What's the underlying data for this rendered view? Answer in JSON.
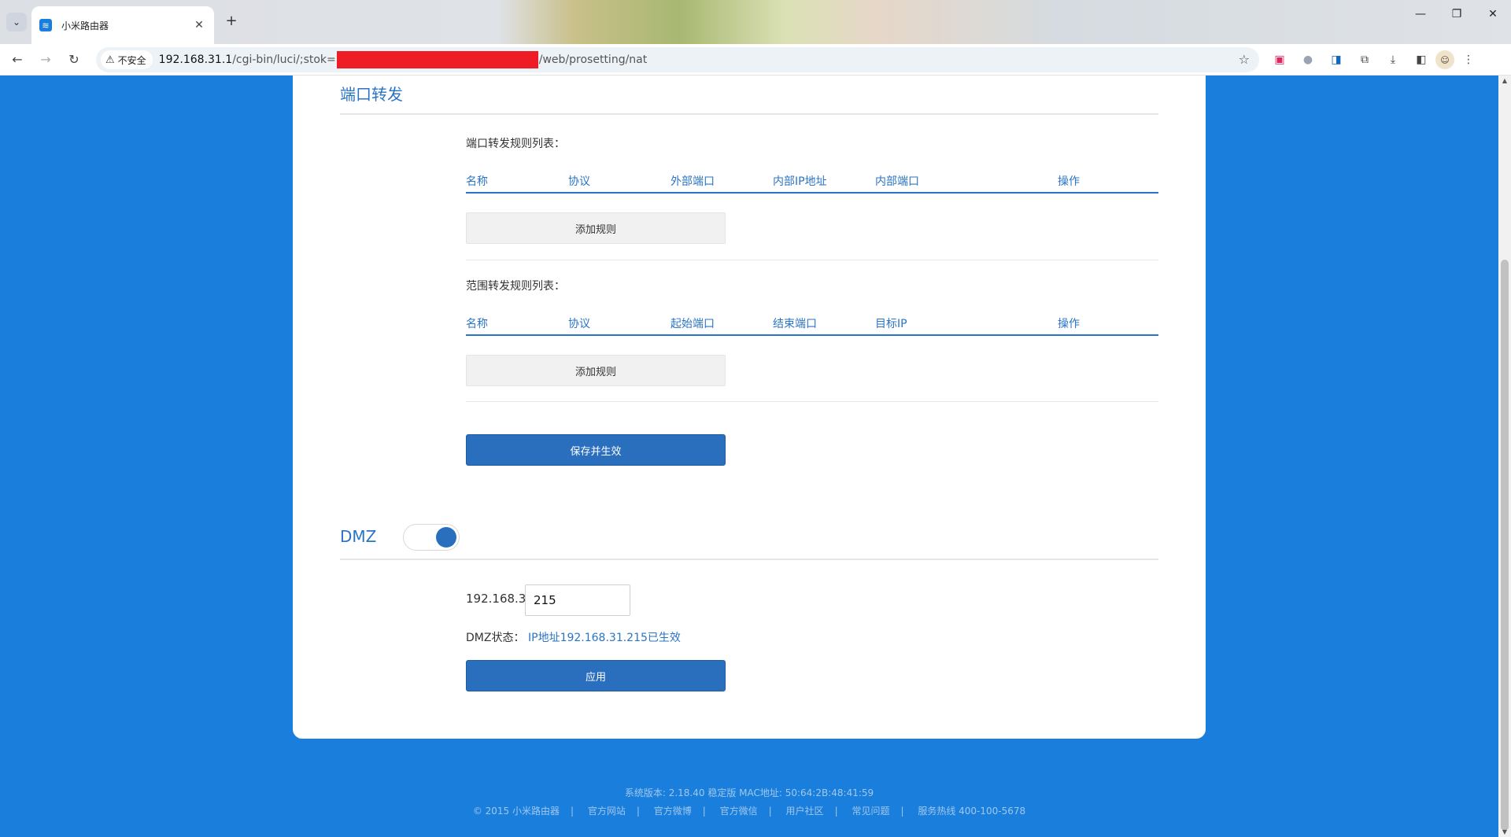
{
  "browser": {
    "tab_title": "小米路由器",
    "security_label": "不安全",
    "url_host": "192.168.31.1",
    "url_path_before": "/cgi-bin/luci/;stok=",
    "url_path_after": "/web/prosetting/nat"
  },
  "port_forward": {
    "title": "端口转发",
    "rules_caption": "端口转发规则列表：",
    "rules_columns": [
      "名称",
      "协议",
      "外部端口",
      "内部IP地址",
      "内部端口",
      "操作"
    ],
    "add_rule_label": "添加规则",
    "range_caption": "范围转发规则列表：",
    "range_columns": [
      "名称",
      "协议",
      "起始端口",
      "结束端口",
      "目标IP",
      "操作"
    ],
    "add_range_label": "添加规则",
    "save_label": "保存并生效"
  },
  "dmz": {
    "title": "DMZ",
    "enabled": true,
    "ip_prefix": "192.168.31.",
    "ip_suffix": "215",
    "status_label": "DMZ状态：",
    "status_value": "IP地址192.168.31.215已生效",
    "apply_label": "应用"
  },
  "footer": {
    "version": "系统版本: 2.18.40 稳定版  MAC地址: 50:64:2B:48:41:59",
    "links": [
      "© 2015 小米路由器",
      "官方网站",
      "官方微博",
      "官方微信",
      "用户社区",
      "常见问题",
      "服务热线 400-100-5678"
    ]
  },
  "colors": {
    "page_background": "#1a7fdc",
    "accent": "#2a74c5",
    "primary_button": "#2a6fbd"
  }
}
